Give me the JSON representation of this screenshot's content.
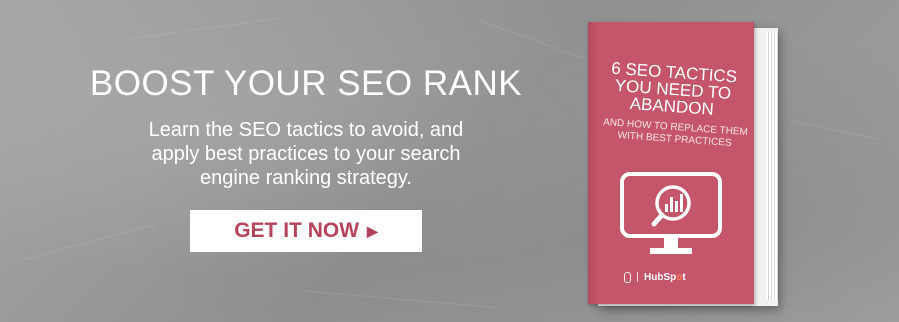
{
  "banner": {
    "headline": "BOOST YOUR SEO RANK",
    "subtext_lines": [
      "Learn the SEO tactics to avoid, and",
      "apply best practices to your search",
      "engine ranking strategy."
    ],
    "cta_label": "GET IT NOW",
    "cta_arrow": "▶"
  },
  "book": {
    "title_lines": [
      "6 SEO TACTICS",
      "YOU NEED TO",
      "ABANDON"
    ],
    "subtitle_lines": [
      "AND HOW TO REPLACE THEM",
      "WITH BEST PRACTICES"
    ],
    "cover_icon": "monitor-search-chart-icon",
    "logos": {
      "left_logo_text": "",
      "right_logo_main": "HubSp",
      "right_logo_accent": "o",
      "right_logo_end": "t"
    }
  },
  "colors": {
    "background": "#9a9b9d",
    "cover": "#c4556b",
    "cta_text": "#b4445b",
    "white": "#ffffff"
  }
}
